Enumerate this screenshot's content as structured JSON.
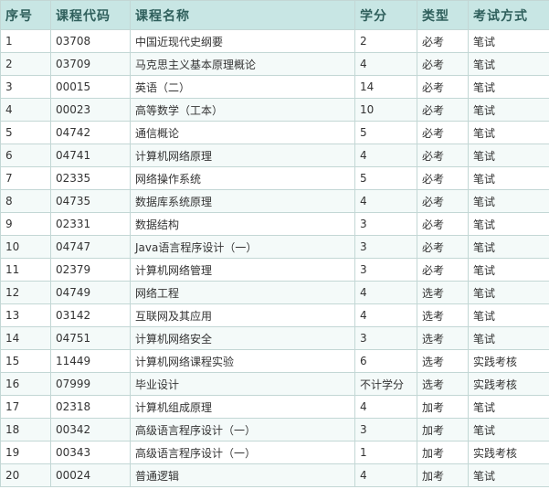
{
  "table": {
    "headers": [
      "序号",
      "课程代码",
      "课程名称",
      "学分",
      "类型",
      "考试方式"
    ],
    "rows": [
      [
        "1",
        "03708",
        "中国近现代史纲要",
        "2",
        "必考",
        "笔试"
      ],
      [
        "2",
        "03709",
        "马克思主义基本原理概论",
        "4",
        "必考",
        "笔试"
      ],
      [
        "3",
        "00015",
        "英语（二）",
        "14",
        "必考",
        "笔试"
      ],
      [
        "4",
        "00023",
        "高等数学（工本）",
        "10",
        "必考",
        "笔试"
      ],
      [
        "5",
        "04742",
        "通信概论",
        "5",
        "必考",
        "笔试"
      ],
      [
        "6",
        "04741",
        "计算机网络原理",
        "4",
        "必考",
        "笔试"
      ],
      [
        "7",
        "02335",
        "网络操作系统",
        "5",
        "必考",
        "笔试"
      ],
      [
        "8",
        "04735",
        "数据库系统原理",
        "4",
        "必考",
        "笔试"
      ],
      [
        "9",
        "02331",
        "数据结构",
        "3",
        "必考",
        "笔试"
      ],
      [
        "10",
        "04747",
        "Java语言程序设计（一）",
        "3",
        "必考",
        "笔试"
      ],
      [
        "11",
        "02379",
        "计算机网络管理",
        "3",
        "必考",
        "笔试"
      ],
      [
        "12",
        "04749",
        "网络工程",
        "4",
        "选考",
        "笔试"
      ],
      [
        "13",
        "03142",
        "互联网及其应用",
        "4",
        "选考",
        "笔试"
      ],
      [
        "14",
        "04751",
        "计算机网络安全",
        "3",
        "选考",
        "笔试"
      ],
      [
        "15",
        "11449",
        "计算机网络课程实验",
        "6",
        "选考",
        "实践考核"
      ],
      [
        "16",
        "07999",
        "毕业设计",
        "不计学分",
        "选考",
        "实践考核"
      ],
      [
        "17",
        "02318",
        "计算机组成原理",
        "4",
        "加考",
        "笔试"
      ],
      [
        "18",
        "00342",
        "高级语言程序设计（一）",
        "3",
        "加考",
        "笔试"
      ],
      [
        "19",
        "00343",
        "高级语言程序设计（一）",
        "1",
        "加考",
        "实践考核"
      ],
      [
        "20",
        "00024",
        "普通逻辑",
        "4",
        "加考",
        "笔试"
      ]
    ]
  }
}
